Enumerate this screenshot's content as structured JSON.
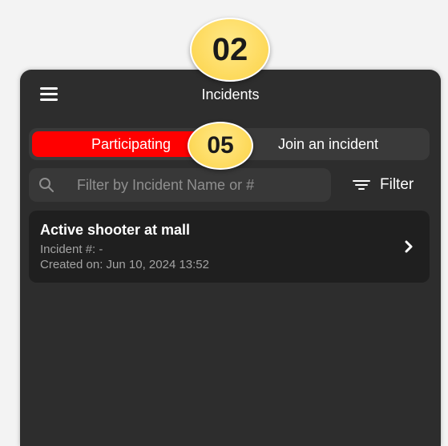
{
  "callouts": {
    "top": "02",
    "segment": "05"
  },
  "header": {
    "title": "Incidents",
    "menu_icon": "hamburger-menu-icon"
  },
  "segments": {
    "active": "Participating",
    "inactive": "Join an incident",
    "active_color": "#ff0000"
  },
  "search": {
    "placeholder": "Filter by Incident Name or #",
    "value": "",
    "icon": "search-icon"
  },
  "filter": {
    "label": "Filter",
    "icon": "filter-lines-icon"
  },
  "incidents": [
    {
      "title": "Active shooter at mall",
      "number_line": "Incident #: -",
      "created_line": "Created on: Jun 10, 2024 13:52"
    }
  ],
  "colors": {
    "background": "#2d2d2d",
    "card": "#1f1f1f",
    "callout": "#fdd95a"
  }
}
